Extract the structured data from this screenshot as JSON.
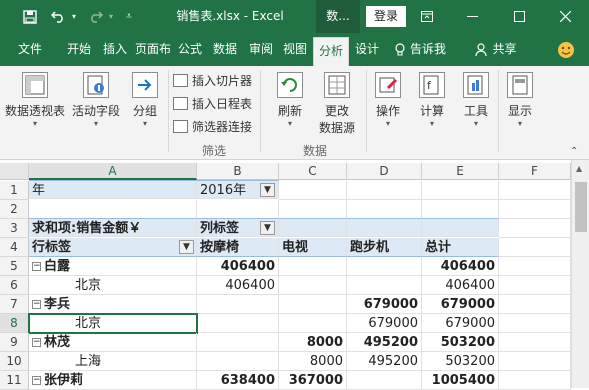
{
  "window": {
    "title": "销售表.xlsx - Excel",
    "context_tab": "数...",
    "login": "登录",
    "accent": "#217346"
  },
  "tabs": [
    "文件",
    "开始",
    "插入",
    "页面布",
    "公式",
    "数据",
    "审阅",
    "视图",
    "分析",
    "设计"
  ],
  "tell_me": "告诉我",
  "share": "共享",
  "ribbon": {
    "pivot_table": "数据透视表",
    "active_field": "活动字段",
    "group": "分组",
    "insert_slicer": "插入切片器",
    "insert_timeline": "插入日程表",
    "filter_connections": "筛选器连接",
    "filter_group": "筛选",
    "refresh": "刷新",
    "change_source_1": "更改",
    "change_source_2": "数据源",
    "data_group": "数据",
    "actions": "操作",
    "calculations": "计算",
    "tools": "工具",
    "show": "显示"
  },
  "columns": [
    "A",
    "B",
    "C",
    "D",
    "E",
    "F"
  ],
  "rows": [
    {
      "num": "1",
      "a": "年",
      "b": "2016年",
      "c": "",
      "d": "",
      "e": ""
    },
    {
      "num": "2",
      "a": "",
      "b": "",
      "c": "",
      "d": "",
      "e": ""
    },
    {
      "num": "3",
      "a": "求和项:销售金额￥",
      "b": "列标签",
      "c": "",
      "d": "",
      "e": ""
    },
    {
      "num": "4",
      "a": "行标签",
      "b": "按摩椅",
      "c": "电视",
      "d": "跑步机",
      "e": "总计"
    },
    {
      "num": "5",
      "a": "白露",
      "b": "406400",
      "c": "",
      "d": "",
      "e": "406400"
    },
    {
      "num": "6",
      "a": "北京",
      "b": "406400",
      "c": "",
      "d": "",
      "e": "406400"
    },
    {
      "num": "7",
      "a": "李兵",
      "b": "",
      "c": "",
      "d": "679000",
      "e": "679000"
    },
    {
      "num": "8",
      "a": "北京",
      "b": "",
      "c": "",
      "d": "679000",
      "e": "679000"
    },
    {
      "num": "9",
      "a": "林茂",
      "b": "",
      "c": "8000",
      "d": "495200",
      "e": "503200"
    },
    {
      "num": "10",
      "a": "上海",
      "b": "",
      "c": "8000",
      "d": "495200",
      "e": "503200"
    },
    {
      "num": "11",
      "a": "张伊莉",
      "b": "638400",
      "c": "367000",
      "d": "",
      "e": "1005400"
    }
  ]
}
